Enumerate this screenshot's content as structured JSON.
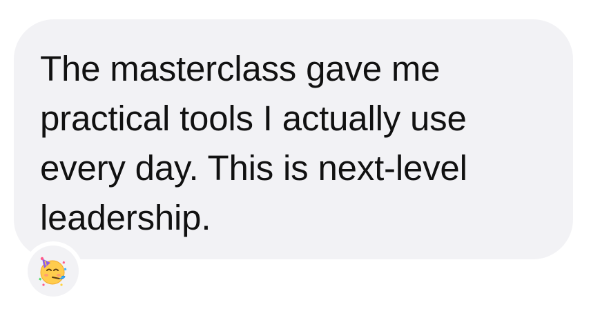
{
  "message": {
    "text_lines": [
      "The masterclass gave me",
      "practical tools I actually use",
      "every day. This is next-level",
      "leadership."
    ]
  },
  "reaction": {
    "icon": "partying-face-icon",
    "emoji": "🥳"
  },
  "colors": {
    "bubble": "#f2f2f5",
    "text": "#111111",
    "background": "#ffffff"
  }
}
